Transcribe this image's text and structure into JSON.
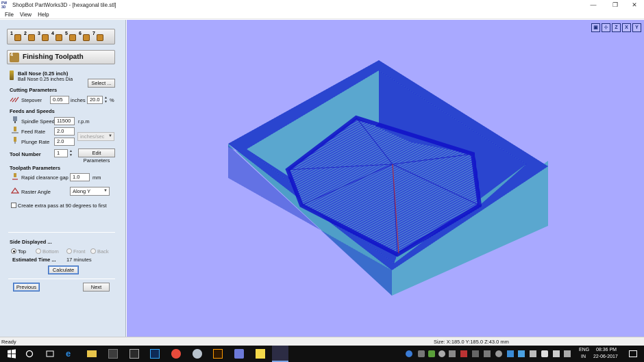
{
  "window": {
    "title": "ShopBot PartWorks3D - [hexagonal tile.stl]",
    "logo_text": "PW 3D",
    "minimize": "—",
    "maximize": "❐",
    "close": "✕"
  },
  "menu": [
    "File",
    "View",
    "Help"
  ],
  "steps": [
    "1",
    "2",
    "3",
    "4",
    "5",
    "6",
    "7"
  ],
  "panel": {
    "header": "Finishing Toolpath",
    "tool_name": "Ball Nose (0.25 inch)",
    "tool_desc": "Ball Nose 0.25 inches Dia",
    "select_button": "Select ...",
    "cutting_params_title": "Cutting Parameters",
    "stepover_label": "Stepover",
    "stepover_value": "0.05",
    "stepover_unit": "inches",
    "stepover_percent": "20.0",
    "percent_sign": "%",
    "feeds_title": "Feeds and Speeds",
    "spindle_label": "Spindle Speed",
    "spindle_value": "11500",
    "spindle_unit": "r.p.m",
    "feed_label": "Feed Rate",
    "feed_value": "2.0",
    "feed_units": "inches/sec",
    "plunge_label": "Plunge Rate",
    "plunge_value": "2.0",
    "tool_number_label": "Tool Number",
    "tool_number_value": "1",
    "edit_params_button": "Edit Parameters",
    "toolpath_params_title": "Toolpath Parameters",
    "rapid_label": "Rapid clearance gap",
    "rapid_value": "1.0",
    "rapid_unit": "mm",
    "raster_label": "Raster Angle",
    "raster_value": "Along Y",
    "extra_pass_label": "Create extra pass at 90 degrees to first",
    "side_title": "Side Displayed ...",
    "side_options": [
      "Top",
      "Bottom",
      "Front",
      "Back"
    ],
    "est_time_label": "Estimated Time ...",
    "est_time_value": "17 minutes",
    "calculate_button": "Calculate",
    "previous_button": "Previous",
    "next_button": "Next"
  },
  "view_icons": [
    "fit-view-icon",
    "view-iso-icon",
    "view-z-icon",
    "view-x-icon",
    "view-y-icon"
  ],
  "view_icon_labels": [
    "▣",
    "⊹",
    "Z",
    "X",
    "Y"
  ],
  "status": {
    "left": "Ready",
    "right": "Size: X:185.0 Y:185.0 Z:43.0 mm"
  },
  "tray": {
    "lang_line1": "ENG",
    "lang_line2": "IN",
    "time": "08:36 PM",
    "date": "22-06-2017"
  },
  "colors": {
    "viewport_bg": "#a9a9ff",
    "panel_bg": "#dce6f2",
    "toolpath": "#1a1adc",
    "block_face": "#4f9ec8"
  }
}
